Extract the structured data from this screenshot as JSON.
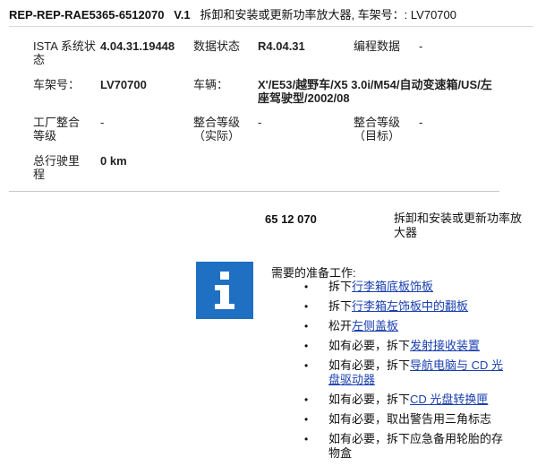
{
  "header": {
    "doc_code": "REP-REP-RAE5365-6512070",
    "version": "V.1",
    "subtitle": "拆卸和安装或更新功率放大器, 车架号：: LV70700"
  },
  "info": {
    "ista_label": "ISTA 系统状态",
    "ista_value": "4.04.31.19448",
    "data_status_label": "数据状态",
    "data_status_value": "R4.04.31",
    "programming_label": "编程数据",
    "programming_value": "-",
    "vin_label": "车架号：",
    "vin_value": "LV70700",
    "vehicle_label": "车辆：",
    "vehicle_value": "X'/E53/越野车/X5 3.0i/M54/自动变速箱/US/左座驾驶型/2002/08",
    "factory_label": "工厂整合等级",
    "factory_value": "-",
    "actual_label": "整合等级（实际）",
    "actual_value": "-",
    "target_label": "整合等级（目标）",
    "target_value": "-",
    "mileage_label": "总行驶里程",
    "mileage_value": "0 km"
  },
  "part": {
    "number": "65 12 070",
    "description": "拆卸和安装或更新功率放大器"
  },
  "icons": {
    "info": "info-icon",
    "info_color": "#1f6fc2"
  },
  "prep": {
    "title": "需要的准备工作:",
    "steps": [
      {
        "prefix": "拆下",
        "link": "行李箱底板饰板",
        "suffix": ""
      },
      {
        "prefix": "拆下",
        "link": "行李箱左饰板中的翻板",
        "suffix": ""
      },
      {
        "prefix": "松开",
        "link": "左侧盖板",
        "suffix": ""
      },
      {
        "prefix": "如有必要，拆下",
        "link": "发射接收装置",
        "suffix": ""
      },
      {
        "prefix": "如有必要，拆下",
        "link": "导航电脑与 CD 光盘驱动器",
        "suffix": ""
      },
      {
        "prefix": "如有必要，拆下",
        "link": "CD 光盘转换匣",
        "suffix": ""
      },
      {
        "prefix": "如有必要，取出警告用三角标志",
        "link": "",
        "suffix": ""
      },
      {
        "prefix": "如有必要，拆下应急备用轮胎的存物盒",
        "link": "",
        "suffix": ""
      }
    ]
  },
  "bullet_char": "•"
}
